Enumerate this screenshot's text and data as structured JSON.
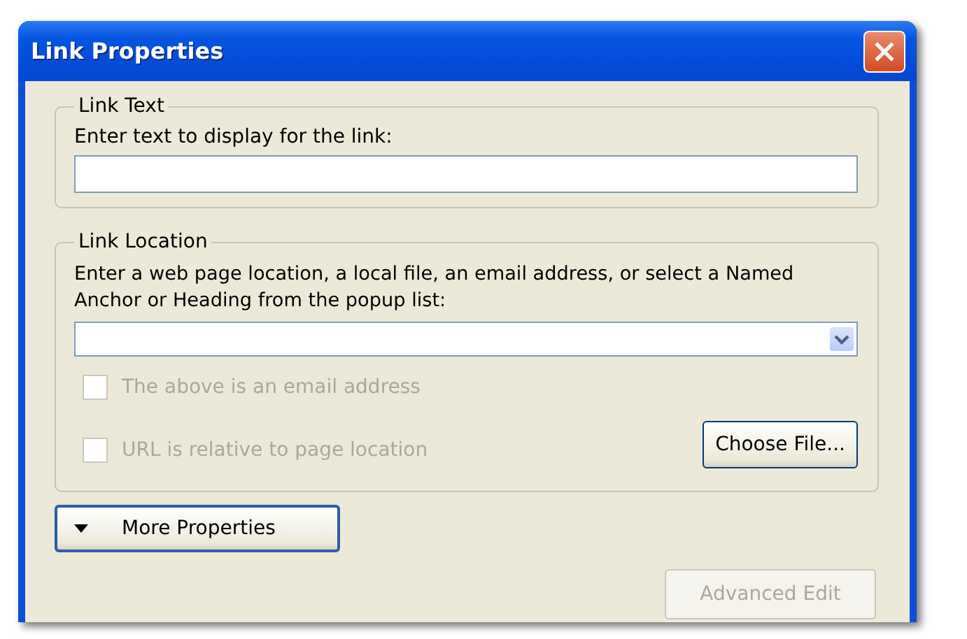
{
  "window": {
    "title": "Link Properties"
  },
  "link_text": {
    "legend": "Link Text",
    "label": "Enter text to display for the link:"
  },
  "link_location": {
    "legend": "Link Location",
    "label": "Enter a web page location, a local file, an email address, or select a Named Anchor or Heading from the popup list:",
    "checkboxes": [
      {
        "label": "The above is an email address",
        "checked": false,
        "disabled": true
      },
      {
        "label": "URL is relative to page location",
        "checked": false,
        "disabled": true
      }
    ],
    "choose_file_button": {
      "label": "Choose File...",
      "disabled": false
    }
  },
  "more_properties_button": {
    "label": "More Properties",
    "expanded": false
  },
  "advanced_edit_button": {
    "label": "Advanced Edit",
    "disabled": true
  }
}
